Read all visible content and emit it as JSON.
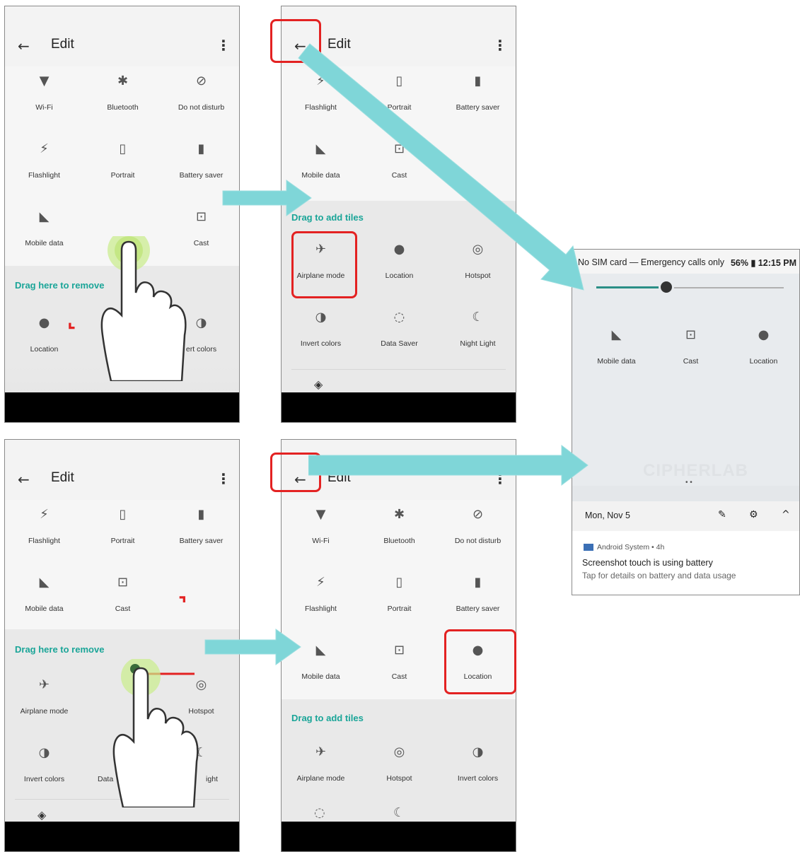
{
  "screens": {
    "top_left": {
      "title": "Edit",
      "tiles": [
        "Wi-Fi",
        "Bluetooth",
        "Do not disturb",
        "Flashlight",
        "Portrait",
        "Battery saver",
        "Mobile data",
        "",
        "Cast",
        "Location",
        "",
        "ert colors"
      ],
      "section": "Drag here to remove"
    },
    "top_middle": {
      "title": "Edit",
      "tiles": [
        "Flashlight",
        "Portrait",
        "Battery saver",
        "Mobile data",
        "Cast"
      ],
      "section": "Drag to add tiles",
      "add_tiles": [
        "Airplane mode",
        "Location",
        "Hotspot",
        "Invert colors",
        "Data Saver",
        "Night Light"
      ]
    },
    "bottom_left": {
      "title": "Edit",
      "tiles": [
        "Flashlight",
        "Portrait",
        "Battery saver",
        "Mobile data",
        "Cast"
      ],
      "section": "Drag here to remove",
      "remove_tiles": [
        "Airplane mode",
        "",
        "Hotspot",
        "Invert colors",
        "Data",
        "ight"
      ]
    },
    "bottom_middle": {
      "title": "Edit",
      "tiles": [
        "Wi-Fi",
        "Bluetooth",
        "Do not disturb",
        "Flashlight",
        "Portrait",
        "Battery saver",
        "Mobile data",
        "Cast",
        "Location"
      ],
      "section": "Drag to add tiles",
      "add_tiles": [
        "Airplane mode",
        "Hotspot",
        "Invert colors"
      ]
    }
  },
  "notification": {
    "status_left": "No SIM card — Emergency calls only",
    "status_right": "56% ▮ 12:15 PM",
    "tiles": [
      "Mobile data",
      "Cast",
      "Location"
    ],
    "date": "Mon, Nov 5",
    "app_line": "Android System • 4h",
    "title": "Screenshot touch is using battery",
    "text": "Tap for details on battery and data usage",
    "watermark": "CIPHERLAB"
  },
  "icons": {
    "back": "←",
    "more": "⋮",
    "wifi": "▼",
    "bluetooth": "✱",
    "dnd": "⊘",
    "flashlight": "⚡",
    "portrait": "▯",
    "battery": "▮",
    "mobile_data": "◣",
    "cast": "⊡",
    "location": "●",
    "airplane": "✈",
    "hotspot": "◎",
    "invert": "◑",
    "data_saver": "◌",
    "night": "☾",
    "edit": "✎",
    "gear": "⚙",
    "chevron_up": "^",
    "diamond": "◈"
  },
  "colors": {
    "accent": "#1aa598",
    "highlight": "#e32222",
    "arrow": "#7fd6d8"
  }
}
